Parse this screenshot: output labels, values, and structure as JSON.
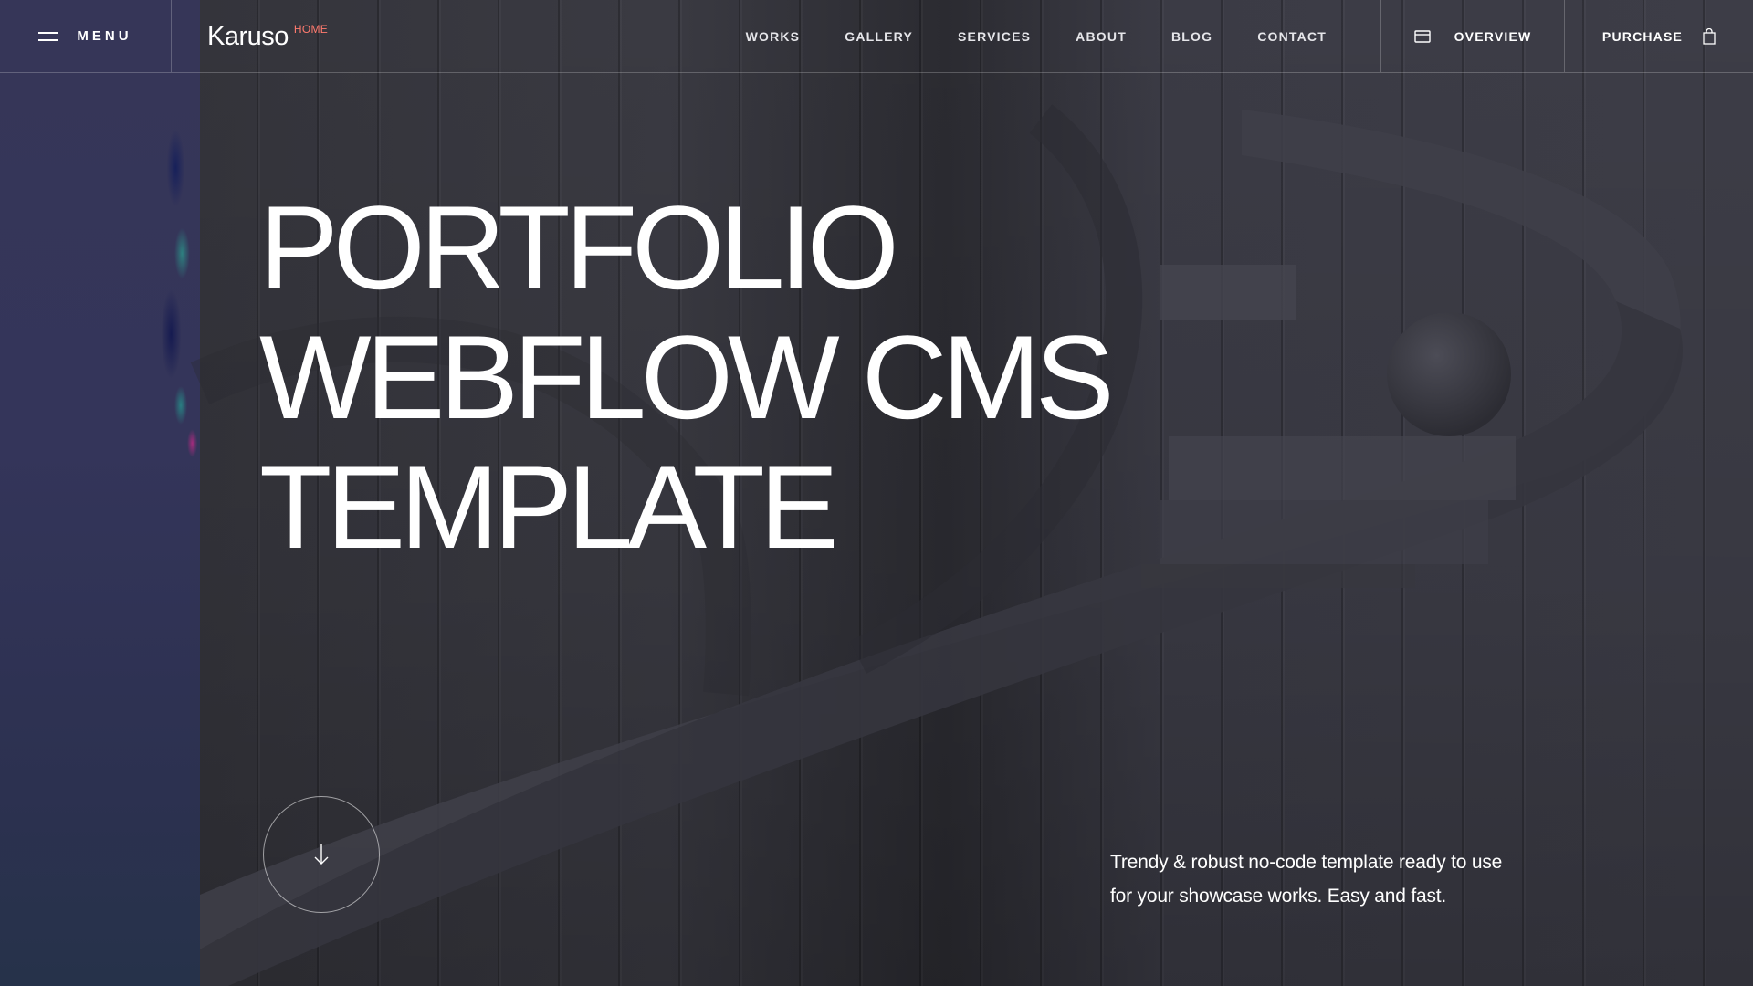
{
  "header": {
    "menu_label": "MENU",
    "logo": {
      "name": "Karuso",
      "sup": "HOME"
    },
    "nav": [
      "WORKS",
      "GALLERY",
      "SERVICES",
      "ABOUT",
      "BLOG",
      "CONTACT"
    ],
    "overview_label": "OVERVIEW",
    "purchase_label": "PURCHASE"
  },
  "hero": {
    "title_lines": [
      "PORTFOLIO",
      "WEBFLOW CMS",
      "TEMPLATE"
    ],
    "description": "Trendy & robust no-code template ready to use for your showcase works. Easy and fast."
  },
  "icons": {
    "menu": "hamburger-icon",
    "overview": "card-icon",
    "purchase": "shopping-bag-icon",
    "scroll": "arrow-down-icon"
  },
  "colors": {
    "accent": "#ff7a6e",
    "background": "#2f2f37",
    "left_panel": "#34355a"
  }
}
